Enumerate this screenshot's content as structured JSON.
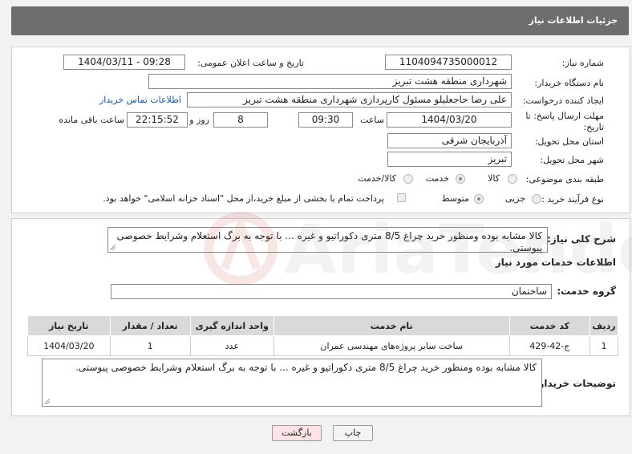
{
  "header": {
    "title": "جزئیات اطلاعات نیاز"
  },
  "form": {
    "need_number_label": "شماره نیاز:",
    "need_number": "1104094735000012",
    "announce_label": "تاریخ و ساعت اعلان عمومی:",
    "announce_value": "1404/03/11 - 09:28",
    "buyer_org_label": "نام دستگاه خریدار:",
    "buyer_org": "شهرداری منطقه هشت تبریز",
    "creator_label": "ایجاد کننده درخواست:",
    "creator": "علی رضا حاجعلیلو مسئول کارپردازی شهرداری منطقه هشت تبریز",
    "contact_link": "اطلاعات تماس خریدار",
    "deadline_label": "مهلت ارسال پاسخ: تا تاریخ:",
    "deadline_date": "1404/03/20",
    "time_label": "ساعت",
    "deadline_time": "09:30",
    "days_value": "8",
    "days_label": "روز و",
    "remaining_time": "22:15:52",
    "remaining_label": "ساعت باقی مانده",
    "province_label": "استان محل تحویل:",
    "province": "آذربایجان شرقی",
    "city_label": "شهر محل تحویل:",
    "city": "تبریز",
    "category_label": "طبقه بندی موضوعی:",
    "category_options": [
      "کالا",
      "خدمت",
      "کالا/خدمت"
    ],
    "category_selected": "خدمت",
    "process_label": "نوع فرآیند خرید :",
    "process_options": [
      "جزیی",
      "متوسط"
    ],
    "process_selected": "متوسط",
    "treasury_text": "پرداخت تمام یا بخشی از مبلغ خرید،از محل \"اسناد خزانه اسلامی\" خواهد بود."
  },
  "summary": {
    "label": "شرح کلی نیاز:",
    "text": "کالا مشابه بوده ومنظور خرید چراغ 8/5 متری دکوراتیو و غیره ... با توجه به برگ استعلام وشرایط خصوصی پیوستی."
  },
  "services": {
    "section_title": "اطلاعات خدمات مورد نیاز",
    "group_label": "گروه خدمت:",
    "group_value": "ساختمان",
    "columns": [
      "ردیف",
      "کد خدمت",
      "نام خدمت",
      "واحد اندازه گیری",
      "تعداد / مقدار",
      "تاریخ نیاز"
    ],
    "rows": [
      [
        "1",
        "ج-42-429",
        "ساخت سایر پروژه‌های مهندسی عمران",
        "عدد",
        "1",
        "1404/03/20"
      ]
    ]
  },
  "buyer_notes": {
    "label": "توضیحات خریدار:",
    "text": "کالا مشابه بوده ومنظور خرید چراغ 8/5 متری دکوراتیو و غیره ... با توجه به برگ استعلام وشرایط خصوصی پیوستی."
  },
  "buttons": {
    "print": "چاپ",
    "back": "بازگشت"
  },
  "watermark": {
    "text": "AriaTender.neT"
  },
  "colors": {
    "header_bg": "#6d6d6d",
    "link": "#1a56b0",
    "back_btn_bg": "#fde3e3"
  }
}
